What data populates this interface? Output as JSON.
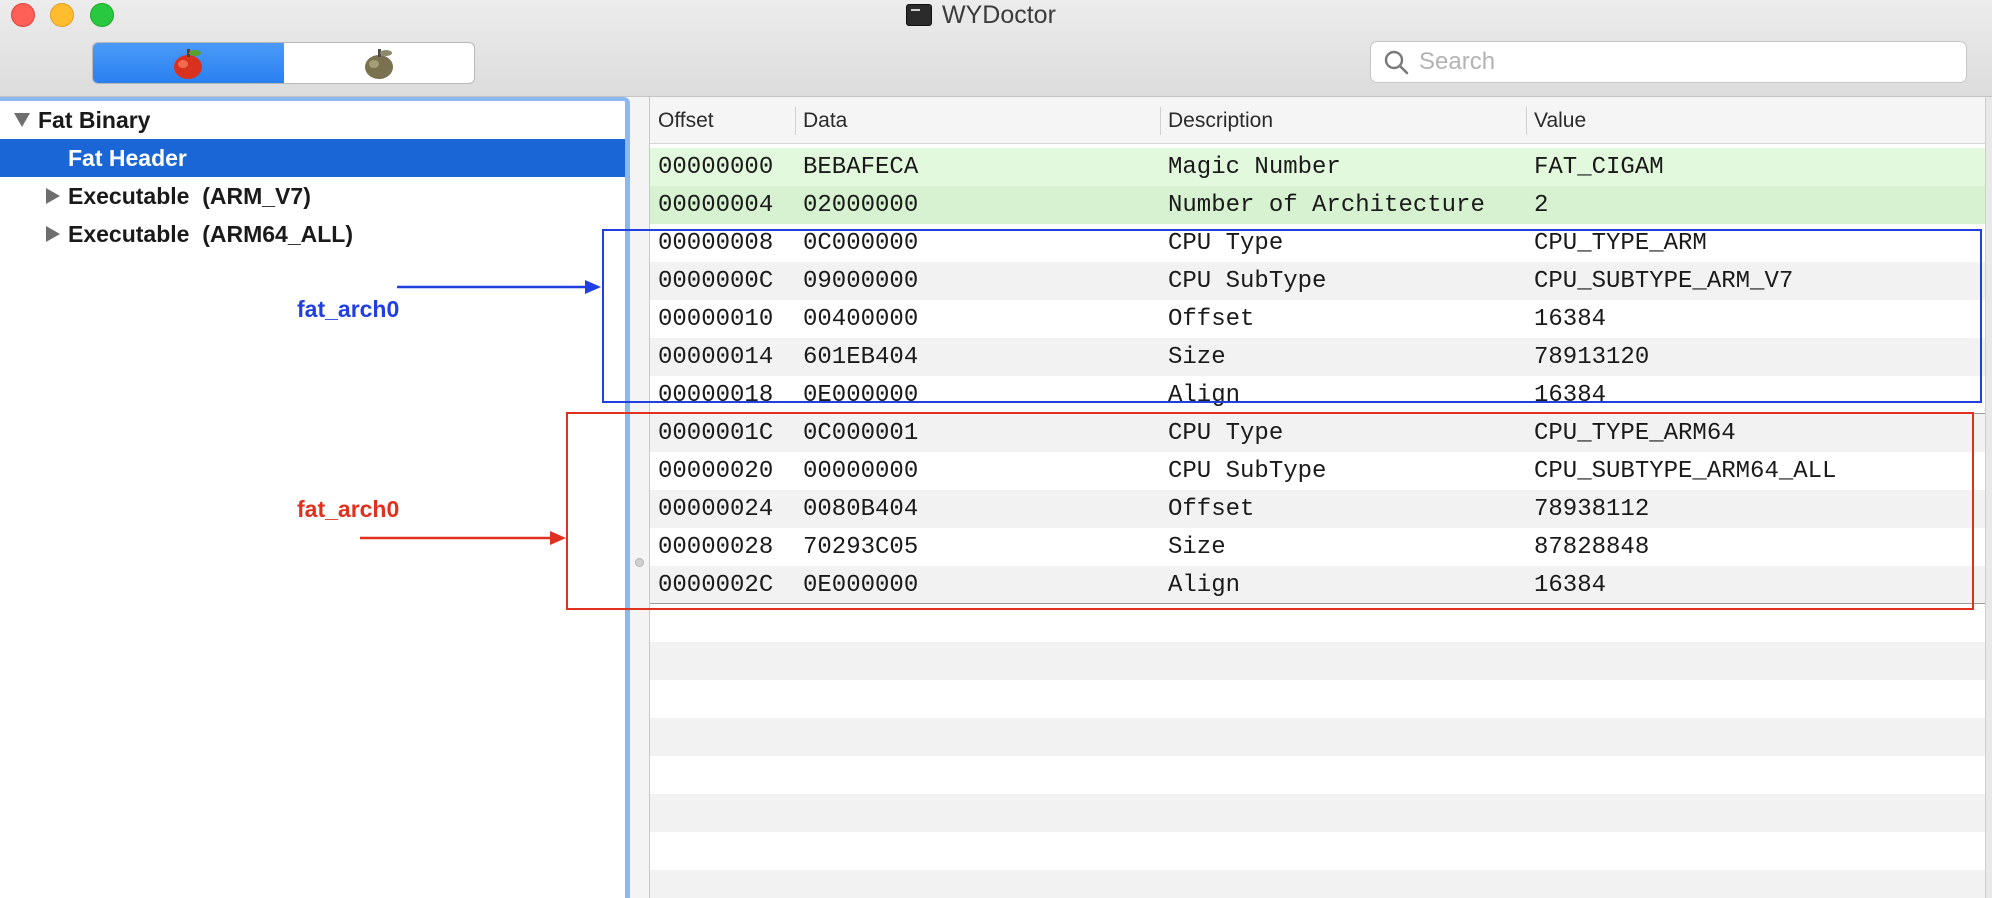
{
  "window": {
    "title": "WYDoctor"
  },
  "toolbar": {
    "segments": [
      {
        "icon": "apple-colored-icon",
        "selected": true
      },
      {
        "icon": "apple-gray-icon",
        "selected": false
      }
    ],
    "search_placeholder": "Search"
  },
  "sidebar": {
    "items": [
      {
        "label": "Fat Binary",
        "level": 0,
        "expanded": true,
        "selected": false
      },
      {
        "label": "Fat Header",
        "level": 1,
        "selected": true
      },
      {
        "label": "Executable  (ARM_V7)",
        "level": 1,
        "expanded": false,
        "selected": false
      },
      {
        "label": "Executable  (ARM64_ALL)",
        "level": 1,
        "expanded": false,
        "selected": false
      }
    ]
  },
  "table": {
    "columns": [
      "Offset",
      "Data",
      "Description",
      "Value"
    ],
    "rows": [
      {
        "offset": "00000000",
        "data": "BEBAFECA",
        "description": "Magic Number",
        "value": "FAT_CIGAM"
      },
      {
        "offset": "00000004",
        "data": "02000000",
        "description": "Number of Architecture",
        "value": "2"
      },
      {
        "offset": "00000008",
        "data": "0C000000",
        "description": "CPU Type",
        "value": "CPU_TYPE_ARM"
      },
      {
        "offset": "0000000C",
        "data": "09000000",
        "description": "CPU SubType",
        "value": "CPU_SUBTYPE_ARM_V7"
      },
      {
        "offset": "00000010",
        "data": "00400000",
        "description": "Offset",
        "value": "16384"
      },
      {
        "offset": "00000014",
        "data": "601EB404",
        "description": "Size",
        "value": "78913120"
      },
      {
        "offset": "00000018",
        "data": "0E000000",
        "description": "Align",
        "value": "16384"
      },
      {
        "offset": "0000001C",
        "data": "0C000001",
        "description": "CPU Type",
        "value": "CPU_TYPE_ARM64"
      },
      {
        "offset": "00000020",
        "data": "00000000",
        "description": "CPU SubType",
        "value": "CPU_SUBTYPE_ARM64_ALL"
      },
      {
        "offset": "00000024",
        "data": "0080B404",
        "description": "Offset",
        "value": "78938112"
      },
      {
        "offset": "00000028",
        "data": "70293C05",
        "description": "Size",
        "value": "87828848"
      },
      {
        "offset": "0000002C",
        "data": "0E000000",
        "description": "Align",
        "value": "16384"
      }
    ]
  },
  "annotations": {
    "blue_label": "fat_arch0",
    "red_label": "fat_arch0",
    "blue_color": "#1f3fe0",
    "red_color": "#e0301e"
  },
  "colors": {
    "selection": "#1a66d6",
    "header_row_green": "#e3f9de"
  }
}
